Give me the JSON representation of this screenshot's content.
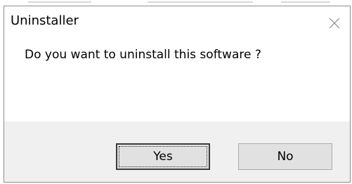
{
  "window": {
    "title": "Uninstaller",
    "close_icon": "close-icon"
  },
  "message": "Do you want to uninstall this software ?",
  "buttons": {
    "yes_label": "Yes",
    "no_label": "No",
    "default": "yes"
  },
  "colors": {
    "window_bg": "#ffffff",
    "button_area_bg": "#f0f0f0",
    "button_face": "#e1e1e1",
    "border": "#8c8c8c",
    "close_glyph": "#8a8a8a"
  }
}
